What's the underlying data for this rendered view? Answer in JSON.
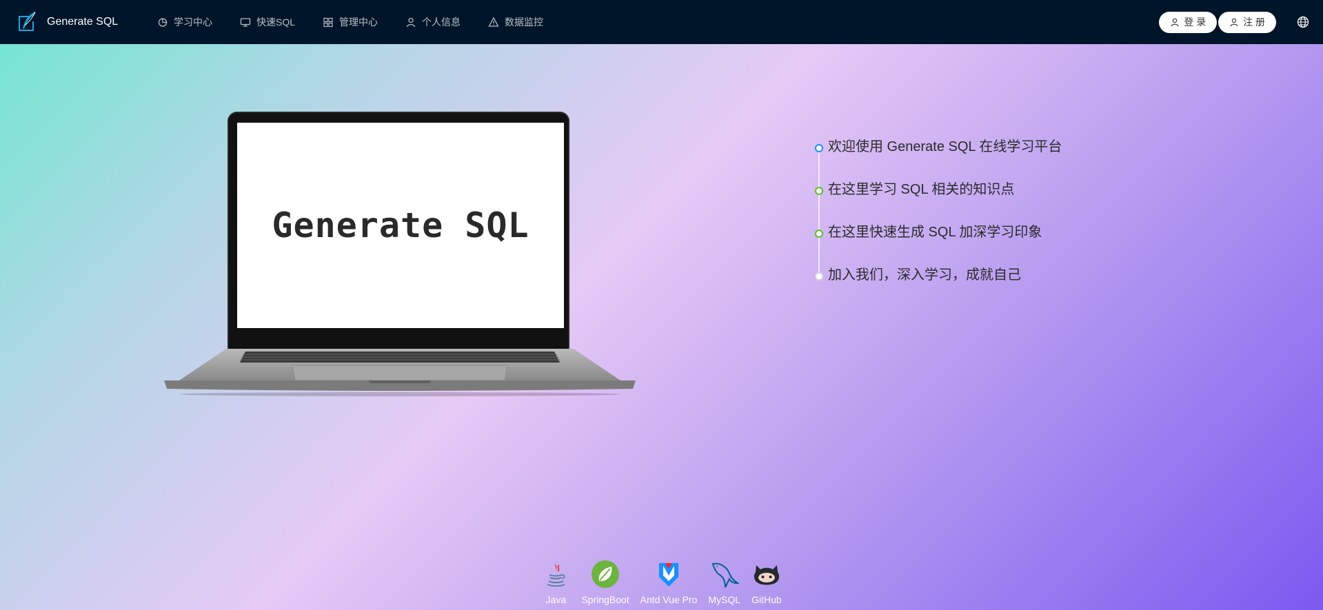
{
  "header": {
    "brand": {
      "title": "Generate SQL",
      "logo_icon": "feather-pen-icon"
    },
    "menu": [
      {
        "label": "学习中心",
        "icon": "chart-pie-icon"
      },
      {
        "label": "快速SQL",
        "icon": "desktop-icon"
      },
      {
        "label": "管理中心",
        "icon": "grid-icon"
      },
      {
        "label": "个人信息",
        "icon": "user-icon"
      },
      {
        "label": "数据监控",
        "icon": "warning-triangle-icon"
      }
    ],
    "login_label": "登 录",
    "register_label": "注 册",
    "language_icon": "globe-icon"
  },
  "hero": {
    "screen_text": "Generate SQL"
  },
  "timeline": [
    {
      "text": "欢迎使用 Generate SQL 在线学习平台",
      "color": "#1890ff"
    },
    {
      "text": "在这里学习 SQL 相关的知识点",
      "color": "#52c41a"
    },
    {
      "text": "在这里快速生成 SQL 加深学习印象",
      "color": "#52c41a"
    },
    {
      "text": "加入我们，深入学习，成就自己",
      "color": "#d9d9d9"
    }
  ],
  "tech_stack": [
    {
      "label": "Java",
      "icon": "java-icon"
    },
    {
      "label": "SpringBoot",
      "icon": "spring-leaf-icon"
    },
    {
      "label": "Antd Vue Pro",
      "icon": "antd-vue-icon"
    },
    {
      "label": "MySQL",
      "icon": "mysql-dolphin-icon"
    },
    {
      "label": "GitHub",
      "icon": "github-octocat-icon"
    }
  ],
  "colors": {
    "navbar_bg": "#001529",
    "accent_blue": "#1890ff",
    "accent_green": "#52c41a"
  }
}
